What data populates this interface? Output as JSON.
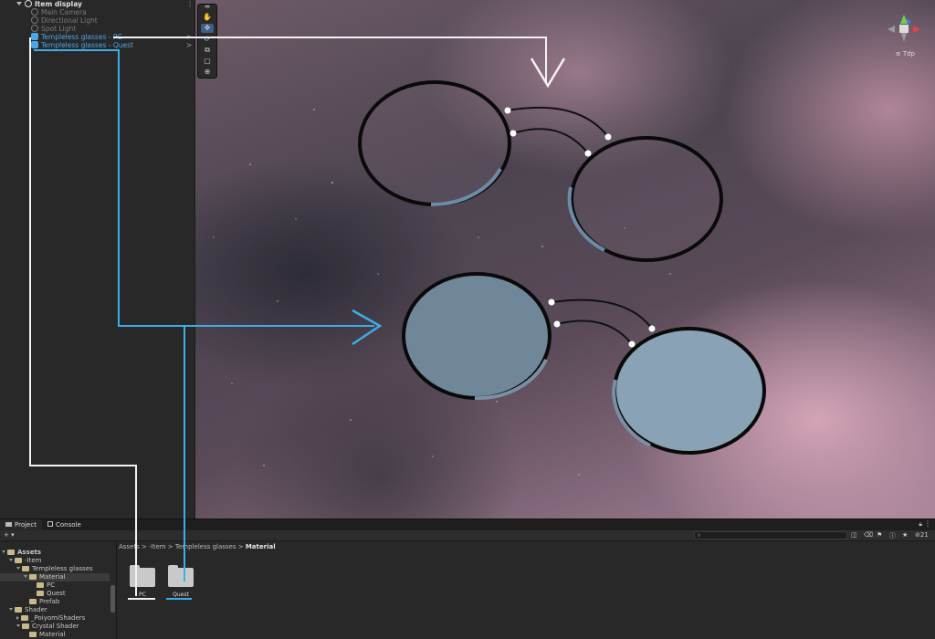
{
  "hierarchy": {
    "scene_name": "Item display",
    "menu_glyph": "⋮",
    "items": [
      {
        "label": "Main Camera",
        "state": "disabled"
      },
      {
        "label": "Directional Light",
        "state": "disabled"
      },
      {
        "label": "Spot Light",
        "state": "disabled"
      },
      {
        "label": "Templeless glasses - PC",
        "state": "prefab"
      },
      {
        "label": "Templeless glasses - Quest",
        "state": "prefab"
      }
    ],
    "expand_glyph": ">"
  },
  "scene": {
    "tools": [
      "hand-tool",
      "move-tool",
      "rotate-tool",
      "scale-tool",
      "rect-tool",
      "transform-tool"
    ],
    "projection_label": "≡ Tdp",
    "annotation_colors": {
      "pc": "#ffffff",
      "quest": "#3daee9"
    }
  },
  "project_panel": {
    "tabs": [
      {
        "label": "Project",
        "active": true
      },
      {
        "label": "Console",
        "active": false
      }
    ],
    "add_label": "+ ▾",
    "search_placeholder": "",
    "hidden_count": "21",
    "breadcrumb": [
      "Assets",
      "-Item",
      "Templeless glasses",
      "Material"
    ],
    "tree": [
      {
        "label": "Assets",
        "bold": true
      },
      {
        "label": "-Item"
      },
      {
        "label": "Templeless glasses"
      },
      {
        "label": "Material",
        "selected": true
      },
      {
        "label": "PC"
      },
      {
        "label": "Quest"
      },
      {
        "label": "Prefab"
      },
      {
        "label": "Shader"
      },
      {
        "label": "_PoiyomiShaders"
      },
      {
        "label": "Crystal Shader"
      },
      {
        "label": "Material"
      }
    ],
    "folders": [
      {
        "label": "PC"
      },
      {
        "label": "Quest"
      }
    ]
  }
}
